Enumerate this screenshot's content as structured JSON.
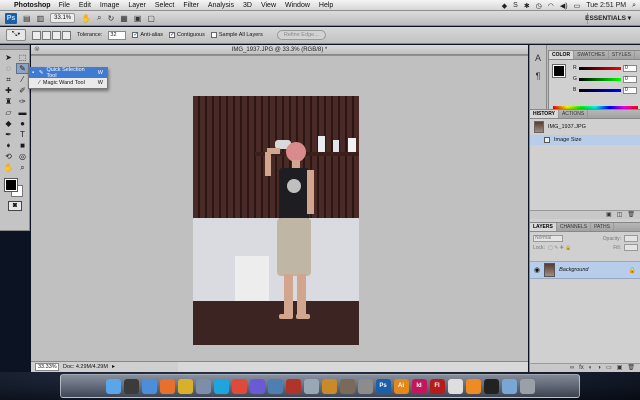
{
  "menubar": {
    "app_name": "Photoshop",
    "items": [
      "File",
      "Edit",
      "Image",
      "Layer",
      "Select",
      "Filter",
      "Analysis",
      "3D",
      "View",
      "Window",
      "Help"
    ],
    "clock": "Tue 2:51 PM"
  },
  "appbar": {
    "logo": "Ps",
    "zoom": "33.1%",
    "workspace": "ESSENTIALS ▾"
  },
  "options": {
    "tolerance_label": "Tolerance:",
    "tolerance_value": "32",
    "anti_alias": "Anti-alias",
    "contiguous": "Contiguous",
    "sample_all": "Sample All Layers",
    "refine": "Refine Edge..."
  },
  "flyout": {
    "items": [
      {
        "label": "Quick Selection Tool",
        "key": "W"
      },
      {
        "label": "Magic Wand Tool",
        "key": "W"
      }
    ]
  },
  "document": {
    "title": "IMG_1937.JPG @ 33.3% (RGB/8) *",
    "zoom_status": "33.33%",
    "doc_size": "Doc: 4.29M/4.29M"
  },
  "panels": {
    "color_tabs": [
      "COLOR",
      "SWATCHES",
      "STYLES"
    ],
    "color_values": {
      "r": "0",
      "g": "0",
      "b": "0"
    },
    "history_tabs": [
      "HISTORY",
      "ACTIONS"
    ],
    "history_snapshot": "IMG_1937.JPG",
    "history_step": "Image Size",
    "layers_tabs": [
      "LAYERS",
      "CHANNELS",
      "PATHS"
    ],
    "blend_mode": "Normal",
    "opacity_label": "Opacity:",
    "lock_label": "Lock:",
    "fill_label": "Fill:",
    "layer_name": "Background"
  },
  "colors": {
    "accent": "#3f7bd1",
    "canvas_bg": "#c0c0c0",
    "selection_row": "#b7cde9"
  },
  "dock": {
    "icons": [
      "finder-icon",
      "dashboard-icon",
      "safari-icon",
      "firefox-icon",
      "chrome-icon",
      "mail-icon",
      "skype-icon",
      "ical-icon",
      "itunes-icon",
      "iphoto-icon",
      "photo-booth-icon",
      "preview-icon",
      "garageband-icon",
      "automator-icon",
      "system-prefs-icon",
      "photoshop-icon",
      "illustrator-icon",
      "indesign-icon",
      "flash-icon",
      "textedit-icon",
      "vlc-icon",
      "dvd-icon",
      "downloads-icon",
      "trash-icon"
    ]
  }
}
